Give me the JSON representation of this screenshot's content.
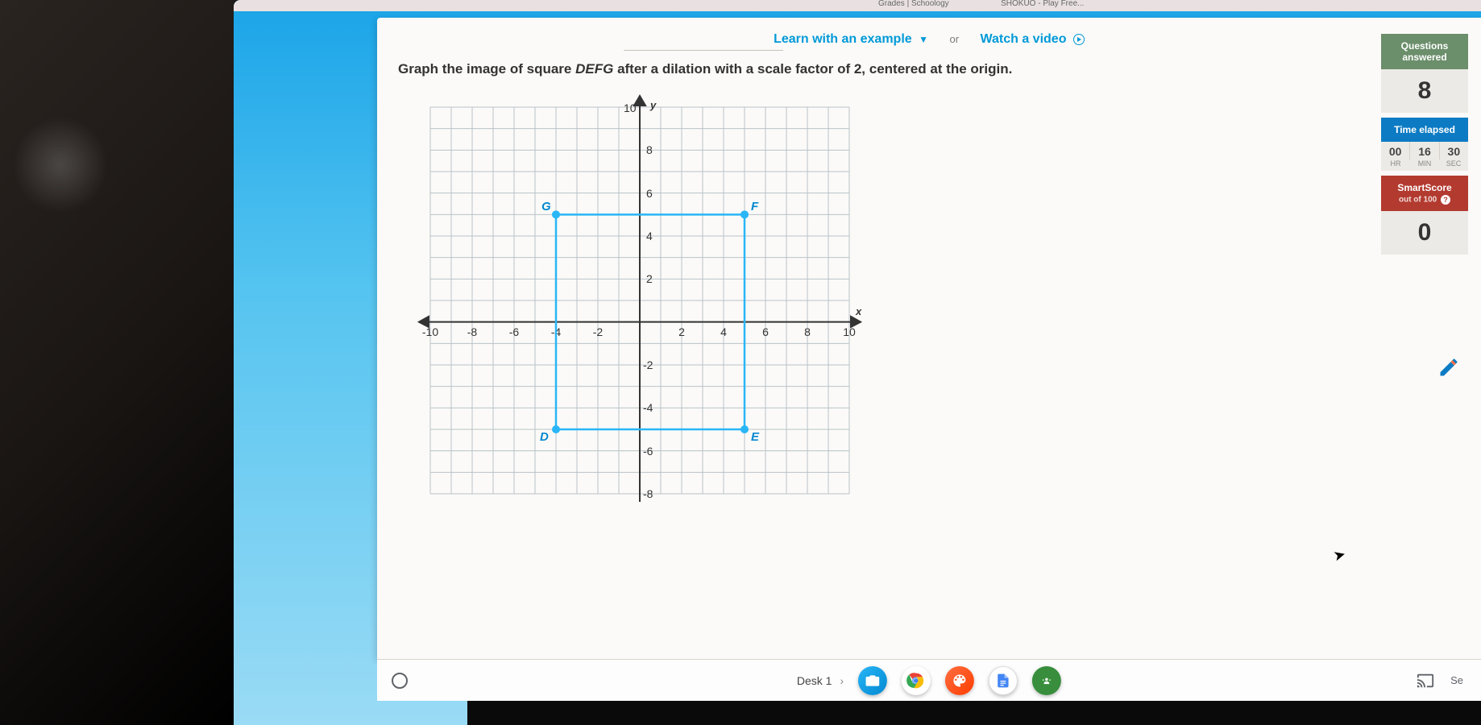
{
  "top_links": {
    "learn": "Learn with an example",
    "or": "or",
    "watch": "Watch a video"
  },
  "question": {
    "pre": "Graph the image of square ",
    "shape": "DEFG",
    "post": " after a dilation with a scale factor of 2, centered at the origin."
  },
  "chart_data": {
    "type": "scatter",
    "title": "",
    "xlabel": "x",
    "ylabel": "y",
    "xlim": [
      -10,
      10
    ],
    "ylim": [
      -8,
      10
    ],
    "xticks": [
      -10,
      -8,
      -6,
      -4,
      -2,
      2,
      4,
      6,
      8,
      10
    ],
    "yticks": [
      10,
      8,
      6,
      4,
      2,
      -2,
      -4,
      -6,
      -8
    ],
    "grid": true,
    "shape_label": "DEFG",
    "vertices": [
      {
        "name": "D",
        "x": -4,
        "y": -5
      },
      {
        "name": "E",
        "x": 5,
        "y": -5
      },
      {
        "name": "F",
        "x": 5,
        "y": 5
      },
      {
        "name": "G",
        "x": -4,
        "y": 5
      }
    ]
  },
  "side": {
    "q_hdr": "Questions answered",
    "q_val": "8",
    "t_hdr": "Time elapsed",
    "hr": "00",
    "min": "16",
    "sec": "30",
    "hr_l": "HR",
    "min_l": "MIN",
    "sec_l": "SEC",
    "s_hdr": "SmartScore",
    "s_sub": "out of 100",
    "s_val": "0"
  },
  "taskbar": {
    "desk": "Desk 1",
    "se": "Se"
  },
  "tabs": {
    "t1": "Grades | Schoology",
    "t2": "SHOKUO - Play Free..."
  }
}
